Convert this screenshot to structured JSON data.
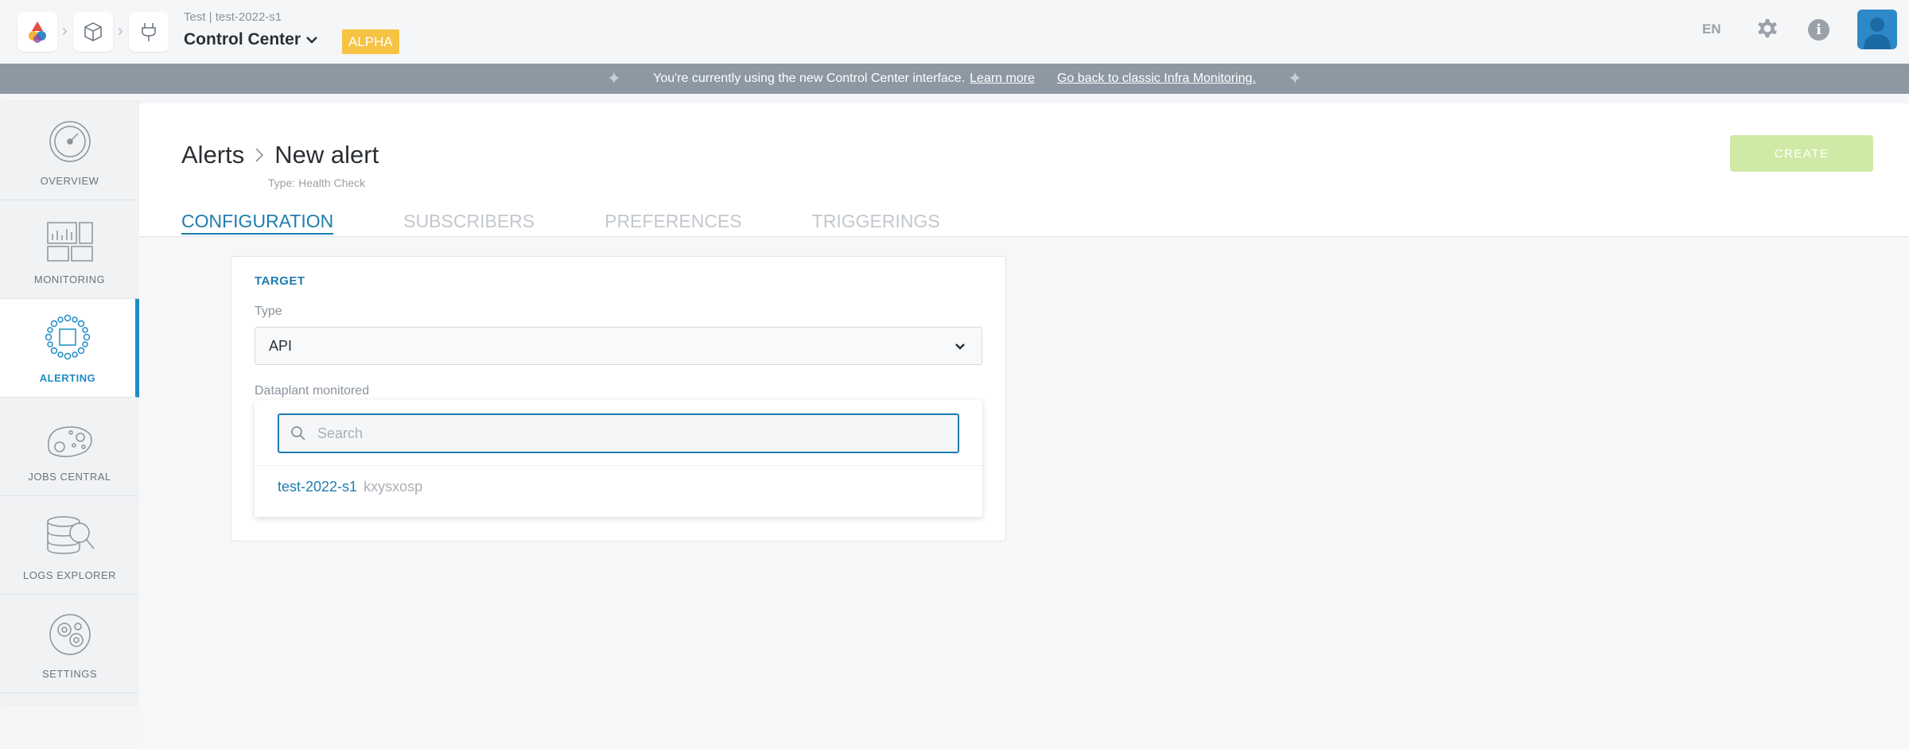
{
  "header": {
    "context_small": "Test | test-2022-s1",
    "context_title": "Control Center",
    "badge": "ALPHA",
    "language": "EN"
  },
  "banner": {
    "message": "You're currently using the new Control Center interface.",
    "learn_more": "Learn more",
    "go_back": "Go back to classic Infra Monitoring."
  },
  "sidebar": {
    "items": [
      {
        "label": "OVERVIEW",
        "icon": "gauge-icon"
      },
      {
        "label": "MONITORING",
        "icon": "monitoring-icon"
      },
      {
        "label": "ALERTING",
        "icon": "alerting-icon",
        "active": true
      },
      {
        "label": "JOBS CENTRAL",
        "icon": "jobs-icon"
      },
      {
        "label": "LOGS EXPLORER",
        "icon": "logs-explorer-icon"
      },
      {
        "label": "SETTINGS",
        "icon": "settings-icon"
      }
    ]
  },
  "page": {
    "breadcrumb_root": "Alerts",
    "breadcrumb_current": "New alert",
    "subtype": "Type: Health Check",
    "create_label": "CREATE"
  },
  "tabs": [
    {
      "label": "CONFIGURATION",
      "active": true
    },
    {
      "label": "SUBSCRIBERS"
    },
    {
      "label": "PREFERENCES"
    },
    {
      "label": "TRIGGERINGS"
    }
  ],
  "form": {
    "section_title": "TARGET",
    "type_label": "Type",
    "type_value": "API",
    "dataplant_label": "Dataplant monitored",
    "search_placeholder": "Search",
    "options": [
      {
        "name": "test-2022-s1",
        "code": "kxysxosp"
      }
    ]
  },
  "colors": {
    "accent": "#1f7cb0",
    "create_button": "#cfeaa7",
    "badge": "#f6c344",
    "banner": "#8d98a3"
  }
}
